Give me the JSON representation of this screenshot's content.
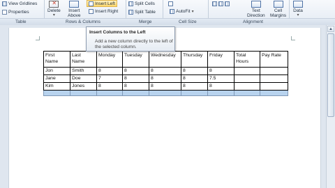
{
  "ribbon": {
    "table_group": {
      "label": "Table",
      "view_gridlines": "View Gridlines",
      "properties": "Properties"
    },
    "rows_columns_group": {
      "label": "Rows & Columns",
      "delete": "Delete",
      "insert_above_line1": "Insert",
      "insert_above_line2": "Above",
      "insert_left": "Insert Left",
      "insert_right": "Insert Right"
    },
    "merge_group": {
      "label": "Merge",
      "split_cells": "Split Cells",
      "split_table": "Split Table"
    },
    "cell_size_group": {
      "label": "Cell Size",
      "autofit": "AutoFit"
    },
    "alignment_group": {
      "label": "Alignment",
      "text_direction_line1": "Text",
      "text_direction_line2": "Direction",
      "cell_margins_line1": "Cell",
      "cell_margins_line2": "Margins"
    },
    "data_group": {
      "label": "Data"
    }
  },
  "tooltip": {
    "title": "Insert Columns to the Left",
    "description": "Add a new column directly to the left of the selected column."
  },
  "table": {
    "headers": [
      [
        "First",
        "Name"
      ],
      [
        "Last",
        "Name"
      ],
      [
        "Monday",
        ""
      ],
      [
        "Tuesday",
        ""
      ],
      [
        "Wednesday",
        ""
      ],
      [
        "Thursday",
        ""
      ],
      [
        "Friday",
        ""
      ],
      [
        "Total",
        "Hours"
      ],
      [
        "Pay Rate",
        ""
      ]
    ],
    "rows": [
      [
        "Jon",
        "Smith",
        "8",
        "8",
        "8",
        "8",
        "8",
        "",
        ""
      ],
      [
        "Jane",
        "Doe",
        "7",
        "8",
        "8",
        "8",
        "7.5",
        "",
        ""
      ],
      [
        "Kim",
        "Jones",
        "8",
        "8",
        "8",
        "8",
        "8",
        "",
        ""
      ],
      [
        "",
        "",
        "",
        "",
        "",
        "",
        "",
        "",
        ""
      ]
    ]
  },
  "colors": {
    "selection": "#b8d3ee",
    "active_button": "#ffd86b"
  }
}
